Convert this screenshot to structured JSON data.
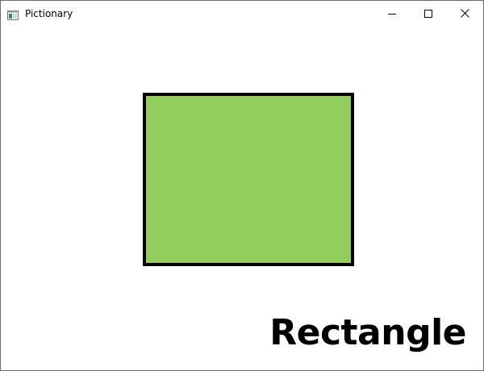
{
  "window": {
    "title": "Pictionary",
    "app_icon": "window-app-icon",
    "controls": {
      "minimize_icon": "minimize-icon",
      "maximize_icon": "maximize-icon",
      "close_icon": "close-icon"
    }
  },
  "canvas": {
    "shape": "rectangle",
    "shape_fill": "#92CD5D",
    "shape_outline": "#000000",
    "label": "Rectangle"
  }
}
